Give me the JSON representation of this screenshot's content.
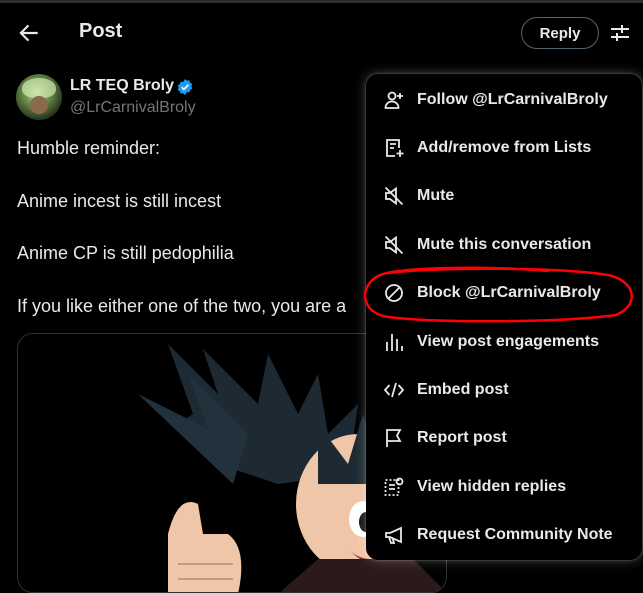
{
  "header": {
    "title": "Post",
    "back_icon": "arrow-left-icon",
    "reply_label": "Reply",
    "settings_icon": "sliders-icon"
  },
  "author": {
    "display_name": "LR TEQ Broly",
    "handle": "@LrCarnivalBroly",
    "verified_icon": "verified-badge-icon",
    "verified_color": "#1d9bf0"
  },
  "tweet": {
    "lines": [
      "Humble reminder:",
      "Anime incest is still incest",
      "Anime CP is still pedophilia",
      "If you like either one of the two, you are a"
    ]
  },
  "menu": {
    "items": [
      {
        "label": "Follow @LrCarnivalBroly",
        "icon": "add-user-icon"
      },
      {
        "label": "Add/remove from Lists",
        "icon": "list-add-icon"
      },
      {
        "label": "Mute",
        "icon": "mute-icon"
      },
      {
        "label": "Mute this conversation",
        "icon": "mute-icon"
      },
      {
        "label": "Block @LrCarnivalBroly",
        "icon": "block-icon"
      },
      {
        "label": "View post engagements",
        "icon": "bar-chart-icon"
      },
      {
        "label": "Embed post",
        "icon": "code-icon"
      },
      {
        "label": "Report post",
        "icon": "flag-icon"
      },
      {
        "label": "View hidden replies",
        "icon": "hidden-replies-icon"
      },
      {
        "label": "Request Community Note",
        "icon": "megaphone-icon"
      }
    ]
  },
  "annotation": {
    "color": "#ff0000",
    "target": "Block @LrCarnivalBroly"
  },
  "colors": {
    "background": "#000000",
    "text_primary": "#e7e9ea",
    "text_secondary": "#71767b",
    "border": "#536471"
  }
}
